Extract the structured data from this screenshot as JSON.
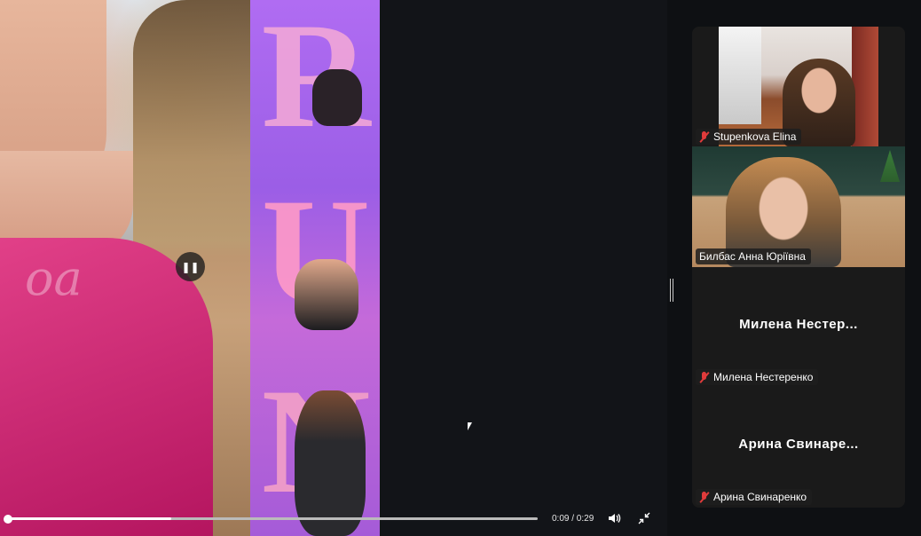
{
  "share": {
    "poster_letters": [
      "R",
      "U",
      "N"
    ],
    "watermark": "oa",
    "controls": {
      "time": "0:09 / 0:29",
      "progress_fraction": 0.31,
      "volume_icon": "speaker-icon",
      "expand_icon": "exit-fullscreen-icon",
      "pause_icon": "pause-icon"
    }
  },
  "gallery": {
    "participants": [
      {
        "label": "Stupenkova Elina",
        "muted": true,
        "video": true
      },
      {
        "label": "Билбас Анна Юріївна",
        "muted": false,
        "video": true,
        "active_speaker": true
      },
      {
        "display_name": "Милена  Нестер...",
        "label": "Милена Нестеренко",
        "muted": true,
        "video": false
      },
      {
        "display_name": "Арина  Свинаре...",
        "label": "Арина Свинаренко",
        "muted": true,
        "video": false
      }
    ]
  },
  "colors": {
    "active_speaker_border": "#23d959",
    "muted_icon": "#e03b3b",
    "tile_bg": "#1a1a1a"
  }
}
